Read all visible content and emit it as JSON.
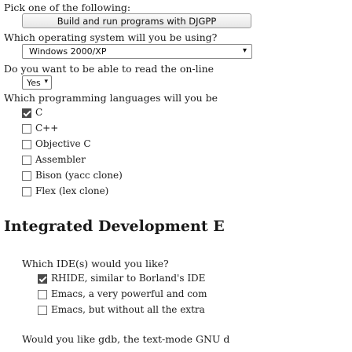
{
  "form": {
    "pick_label": "Pick one of the following:",
    "pick_button": "Build and run programs with DJGPP",
    "os_label": "Which operating system will you be using?",
    "os_value": "Windows 2000/XP",
    "online_label": "Do you want to be able to read the on-line",
    "online_value": "Yes",
    "languages_label": "Which programming languages will you be",
    "languages": [
      {
        "label": "C",
        "checked": true
      },
      {
        "label": "C++",
        "checked": false
      },
      {
        "label": "Objective C",
        "checked": false
      },
      {
        "label": "Assembler",
        "checked": false
      },
      {
        "label": "Bison (yacc clone)",
        "checked": false
      },
      {
        "label": "Flex (lex clone)",
        "checked": false
      }
    ]
  },
  "section": {
    "title": "Integrated Development E",
    "ide_label": "Which IDE(s) would you like?",
    "ides": [
      {
        "label": "RHIDE, similar to Borland's IDE",
        "checked": true
      },
      {
        "label": "Emacs, a very powerful and com",
        "checked": false
      },
      {
        "label": "Emacs, but without all the extra",
        "checked": false
      }
    ],
    "bottom_text": "Would you like gdb, the text-mode GNU d"
  }
}
